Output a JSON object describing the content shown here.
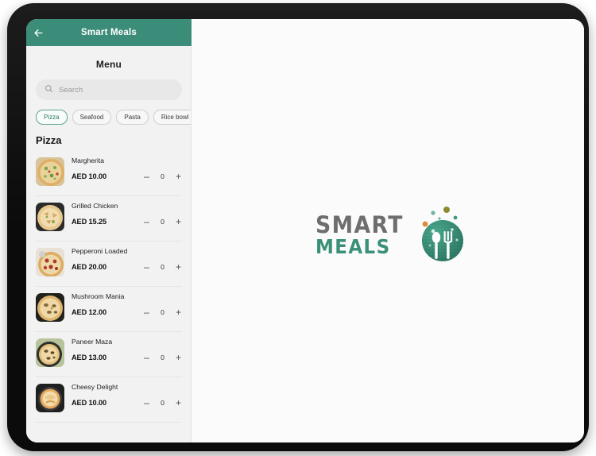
{
  "app": {
    "header": {
      "title": "Smart Meals",
      "back_icon": "arrow-left-icon",
      "accent_color": "#3c8c7a"
    },
    "sidebar": {
      "menu_title": "Menu",
      "search": {
        "placeholder": "Search",
        "value": "",
        "icon": "search-icon"
      },
      "filter_chips": [
        {
          "label": "Pizza",
          "active": true
        },
        {
          "label": "Seafood",
          "active": false
        },
        {
          "label": "Pasta",
          "active": false
        },
        {
          "label": "Rice bowl",
          "active": false
        }
      ],
      "section_title": "Pizza",
      "items": [
        {
          "name": "Margherita",
          "price": "AED 10.00",
          "qty": "0",
          "minus": "–",
          "plus": "+",
          "thumb": "pizza-margherita-thumbnail"
        },
        {
          "name": "Grilled Chicken",
          "price": "AED 15.25",
          "qty": "0",
          "minus": "–",
          "plus": "+",
          "thumb": "pizza-grilled-chicken-thumbnail"
        },
        {
          "name": "Pepperoni Loaded",
          "price": "AED 20.00",
          "qty": "0",
          "minus": "–",
          "plus": "+",
          "thumb": "pizza-pepperoni-thumbnail"
        },
        {
          "name": "Mushroom Mania",
          "price": "AED 12.00",
          "qty": "0",
          "minus": "–",
          "plus": "+",
          "thumb": "pizza-mushroom-thumbnail"
        },
        {
          "name": "Paneer Maza",
          "price": "AED 13.00",
          "qty": "0",
          "minus": "–",
          "plus": "+",
          "thumb": "pizza-paneer-thumbnail"
        },
        {
          "name": "Cheesy Delight",
          "price": "AED 10.00",
          "qty": "0",
          "minus": "–",
          "plus": "+",
          "thumb": "pizza-cheesy-thumbnail"
        }
      ]
    },
    "main": {
      "logo": {
        "line1": "SMART",
        "line2": "MEALS",
        "mark": "plate-spoon-fork-icon",
        "line1_color": "#6e6e6e",
        "line2_color": "#3a9078",
        "mark_color": "#2e7f69",
        "dot_colors": [
          "#6fb3a0",
          "#8a8a2f",
          "#e08b3a",
          "#3f9a80"
        ]
      }
    }
  }
}
